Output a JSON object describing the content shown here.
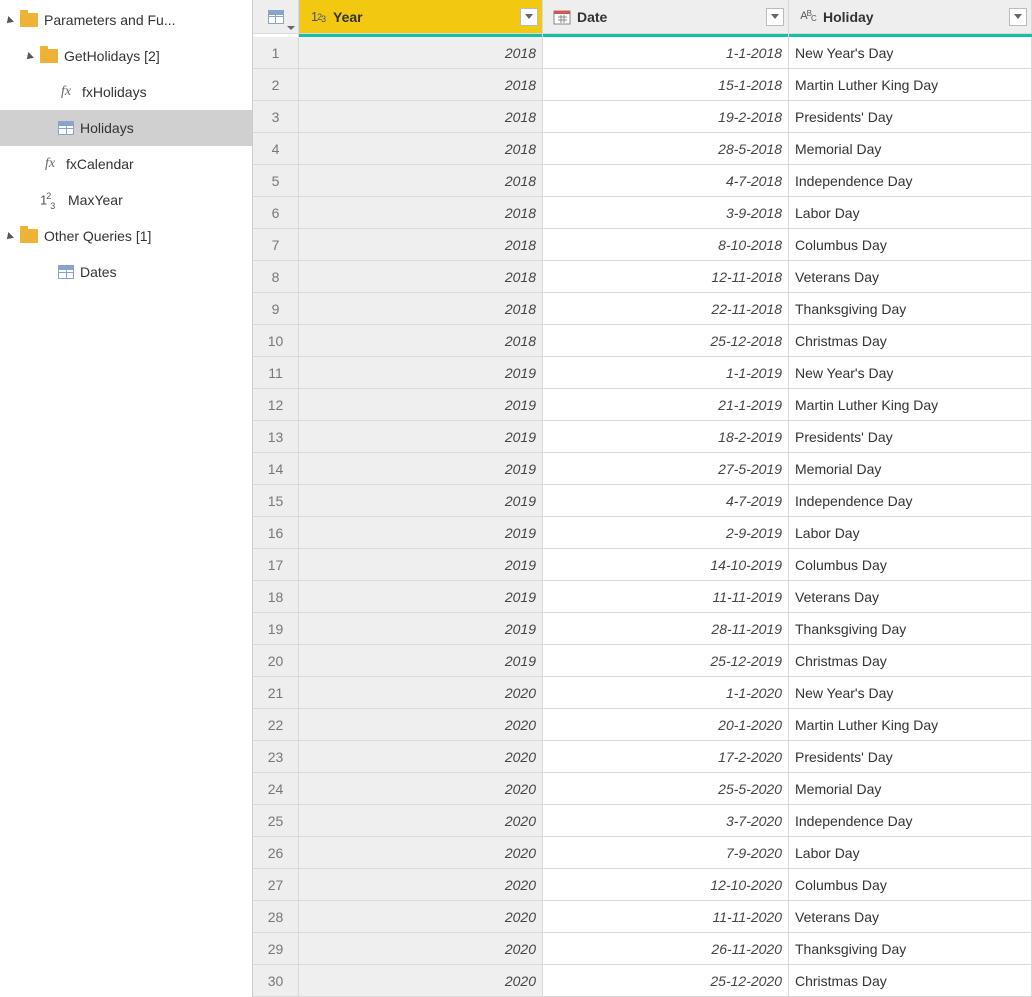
{
  "tree": {
    "root_label": "Parameters and Fu...",
    "groups": [
      {
        "label": "GetHolidays [2]",
        "items": [
          {
            "type": "fx",
            "label": "fxHolidays",
            "selected": false
          },
          {
            "type": "table",
            "label": "Holidays",
            "selected": true
          }
        ]
      }
    ],
    "loose_items": [
      {
        "type": "fx",
        "label": "fxCalendar"
      },
      {
        "type": "num",
        "label": "MaxYear"
      }
    ],
    "other_group": {
      "label": "Other Queries [1]",
      "items": [
        {
          "type": "table",
          "label": "Dates"
        }
      ]
    }
  },
  "grid": {
    "columns": {
      "year": {
        "label": "Year",
        "type": "number",
        "selected": true
      },
      "date": {
        "label": "Date",
        "type": "date",
        "selected": false
      },
      "holiday": {
        "label": "Holiday",
        "type": "text",
        "selected": false
      }
    },
    "rows": [
      {
        "n": 1,
        "year": "2018",
        "date": "1-1-2018",
        "holiday": "New Year's Day"
      },
      {
        "n": 2,
        "year": "2018",
        "date": "15-1-2018",
        "holiday": "Martin Luther King Day"
      },
      {
        "n": 3,
        "year": "2018",
        "date": "19-2-2018",
        "holiday": "Presidents' Day"
      },
      {
        "n": 4,
        "year": "2018",
        "date": "28-5-2018",
        "holiday": "Memorial Day"
      },
      {
        "n": 5,
        "year": "2018",
        "date": "4-7-2018",
        "holiday": "Independence Day"
      },
      {
        "n": 6,
        "year": "2018",
        "date": "3-9-2018",
        "holiday": "Labor Day"
      },
      {
        "n": 7,
        "year": "2018",
        "date": "8-10-2018",
        "holiday": "Columbus Day"
      },
      {
        "n": 8,
        "year": "2018",
        "date": "12-11-2018",
        "holiday": "Veterans Day"
      },
      {
        "n": 9,
        "year": "2018",
        "date": "22-11-2018",
        "holiday": "Thanksgiving Day"
      },
      {
        "n": 10,
        "year": "2018",
        "date": "25-12-2018",
        "holiday": "Christmas Day"
      },
      {
        "n": 11,
        "year": "2019",
        "date": "1-1-2019",
        "holiday": "New Year's Day"
      },
      {
        "n": 12,
        "year": "2019",
        "date": "21-1-2019",
        "holiday": "Martin Luther King Day"
      },
      {
        "n": 13,
        "year": "2019",
        "date": "18-2-2019",
        "holiday": "Presidents' Day"
      },
      {
        "n": 14,
        "year": "2019",
        "date": "27-5-2019",
        "holiday": "Memorial Day"
      },
      {
        "n": 15,
        "year": "2019",
        "date": "4-7-2019",
        "holiday": "Independence Day"
      },
      {
        "n": 16,
        "year": "2019",
        "date": "2-9-2019",
        "holiday": "Labor Day"
      },
      {
        "n": 17,
        "year": "2019",
        "date": "14-10-2019",
        "holiday": "Columbus Day"
      },
      {
        "n": 18,
        "year": "2019",
        "date": "11-11-2019",
        "holiday": "Veterans Day"
      },
      {
        "n": 19,
        "year": "2019",
        "date": "28-11-2019",
        "holiday": "Thanksgiving Day"
      },
      {
        "n": 20,
        "year": "2019",
        "date": "25-12-2019",
        "holiday": "Christmas Day"
      },
      {
        "n": 21,
        "year": "2020",
        "date": "1-1-2020",
        "holiday": "New Year's Day"
      },
      {
        "n": 22,
        "year": "2020",
        "date": "20-1-2020",
        "holiday": "Martin Luther King Day"
      },
      {
        "n": 23,
        "year": "2020",
        "date": "17-2-2020",
        "holiday": "Presidents' Day"
      },
      {
        "n": 24,
        "year": "2020",
        "date": "25-5-2020",
        "holiday": "Memorial Day"
      },
      {
        "n": 25,
        "year": "2020",
        "date": "3-7-2020",
        "holiday": "Independence Day"
      },
      {
        "n": 26,
        "year": "2020",
        "date": "7-9-2020",
        "holiday": "Labor Day"
      },
      {
        "n": 27,
        "year": "2020",
        "date": "12-10-2020",
        "holiday": "Columbus Day"
      },
      {
        "n": 28,
        "year": "2020",
        "date": "11-11-2020",
        "holiday": "Veterans Day"
      },
      {
        "n": 29,
        "year": "2020",
        "date": "26-11-2020",
        "holiday": "Thanksgiving Day"
      },
      {
        "n": 30,
        "year": "2020",
        "date": "25-12-2020",
        "holiday": "Christmas Day"
      }
    ]
  }
}
